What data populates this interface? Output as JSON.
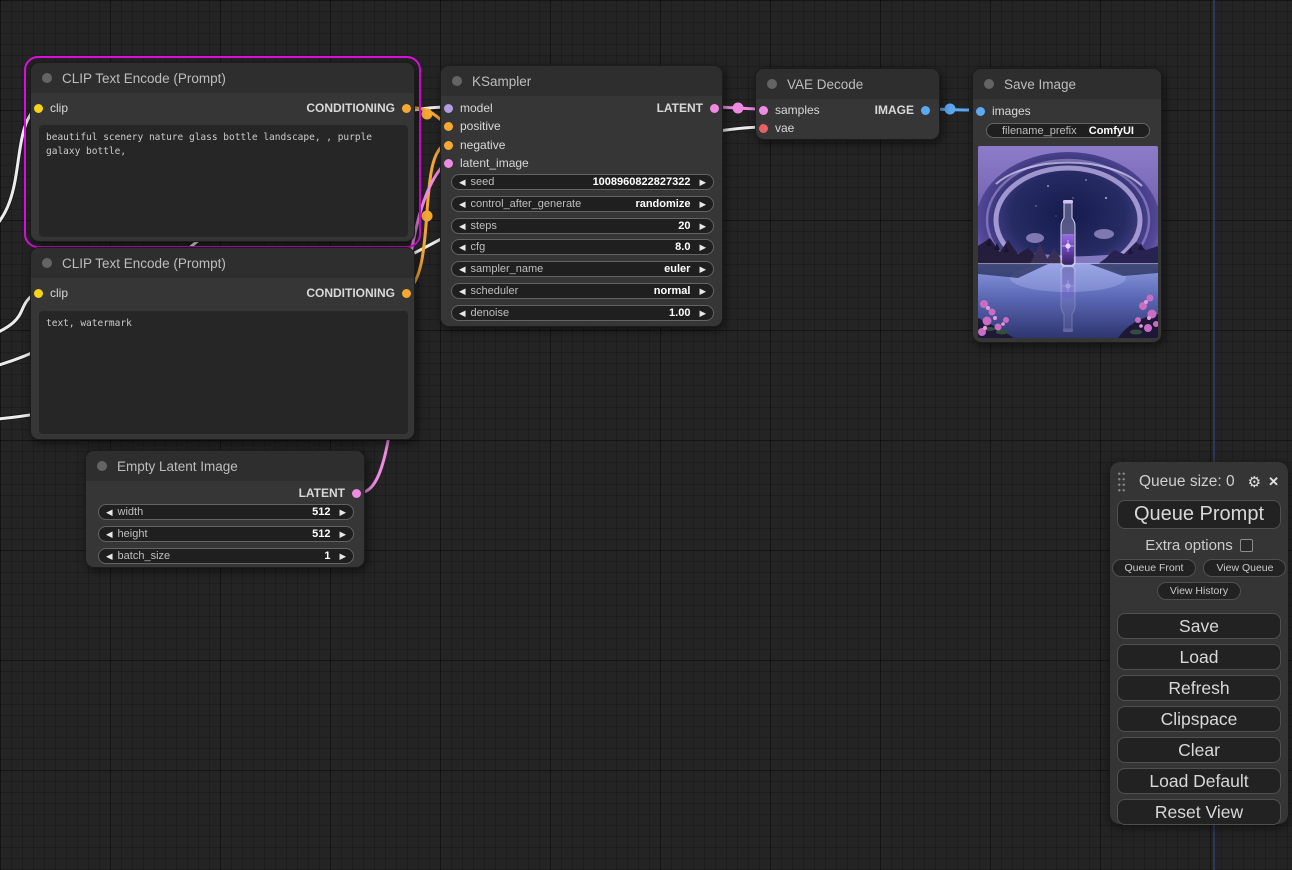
{
  "glyphs": {
    "left_arrow": "◀",
    "right_arrow": "▶",
    "gear": "⚙",
    "close": "✕"
  },
  "colors": {
    "selection": "#e10fe1",
    "wire_white": "#ededed",
    "wire_orange": "#f7a831",
    "wire_pink": "#ef8be3",
    "wire_blue": "#5da9f2",
    "slot_yellow": "#f8d31c",
    "slot_orange": "#f7a831",
    "slot_purple": "#b39ddb",
    "slot_pink": "#ef8be3",
    "slot_red": "#e56262",
    "slot_blue": "#5da9f2"
  },
  "nodes": {
    "clip_positive": {
      "title": "CLIP Text Encode (Prompt)",
      "input": "clip",
      "output": "CONDITIONING",
      "prompt": "beautiful scenery nature glass bottle landscape, , purple galaxy bottle,"
    },
    "clip_negative": {
      "title": "CLIP Text Encode (Prompt)",
      "input": "clip",
      "output": "CONDITIONING",
      "prompt": "text, watermark"
    },
    "ksampler": {
      "title": "KSampler",
      "inputs": [
        "model",
        "positive",
        "negative",
        "latent_image"
      ],
      "output": "LATENT",
      "widgets": [
        {
          "label": "seed",
          "value": "1008960822827322"
        },
        {
          "label": "control_after_generate",
          "value": "randomize"
        },
        {
          "label": "steps",
          "value": "20"
        },
        {
          "label": "cfg",
          "value": "8.0"
        },
        {
          "label": "sampler_name",
          "value": "euler"
        },
        {
          "label": "scheduler",
          "value": "normal"
        },
        {
          "label": "denoise",
          "value": "1.00"
        }
      ]
    },
    "vae_decode": {
      "title": "VAE Decode",
      "inputs": [
        "samples",
        "vae"
      ],
      "output": "IMAGE"
    },
    "save_image": {
      "title": "Save Image",
      "input": "images",
      "widgets": [
        {
          "label": "filename_prefix",
          "value": "ComfyUI"
        }
      ]
    },
    "empty_latent": {
      "title": "Empty Latent Image",
      "output": "LATENT",
      "widgets": [
        {
          "label": "width",
          "value": "512"
        },
        {
          "label": "height",
          "value": "512"
        },
        {
          "label": "batch_size",
          "value": "1"
        }
      ]
    }
  },
  "menu": {
    "queue_size": "Queue size: 0",
    "queue_prompt": "Queue Prompt",
    "extra_options": "Extra options",
    "queue_front": "Queue Front",
    "view_queue": "View Queue",
    "view_history": "View History",
    "buttons": [
      "Save",
      "Load",
      "Refresh",
      "Clipspace",
      "Clear",
      "Load Default",
      "Reset View"
    ]
  }
}
